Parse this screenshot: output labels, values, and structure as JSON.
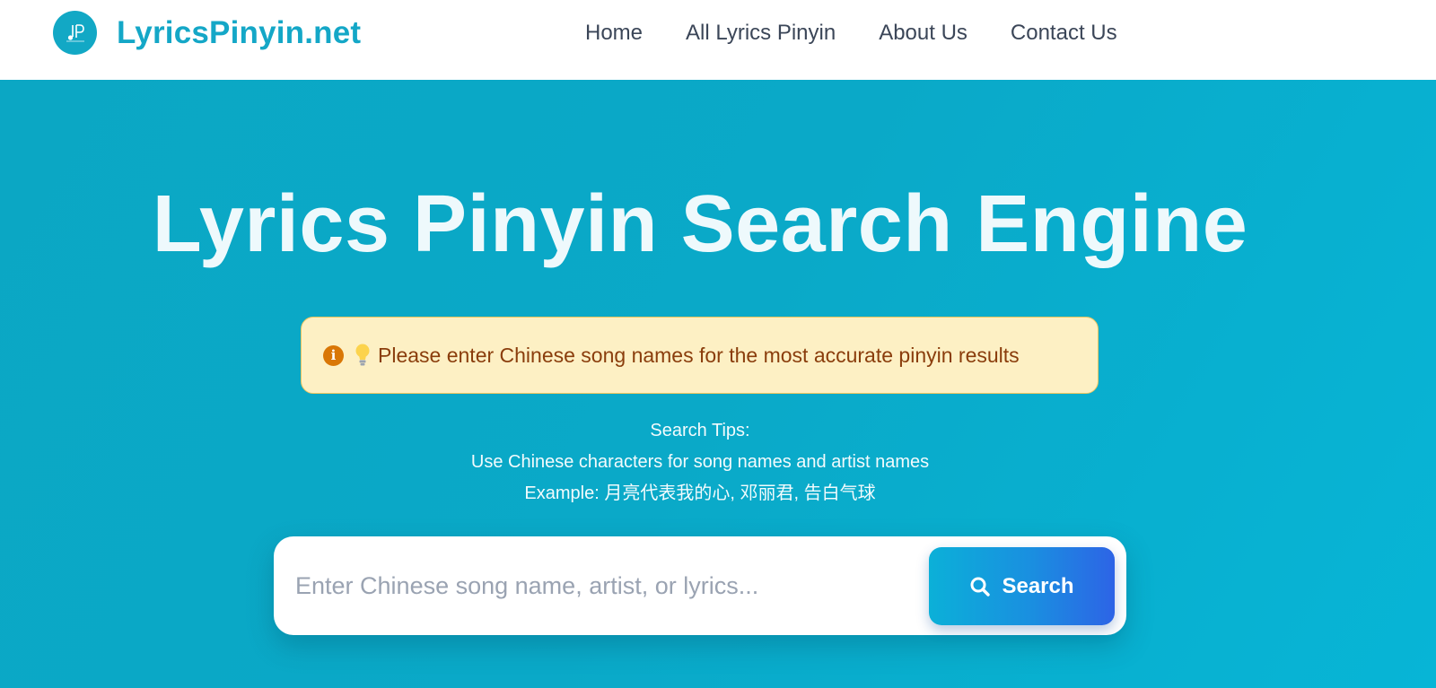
{
  "brand": {
    "name": "LyricsPinyin.net",
    "color": "#14a7c7"
  },
  "nav": {
    "items": [
      {
        "label": "Home"
      },
      {
        "label": "All Lyrics Pinyin"
      },
      {
        "label": "About Us"
      },
      {
        "label": "Contact Us"
      }
    ]
  },
  "hero": {
    "title": "Lyrics Pinyin Search Engine",
    "background": "#0aa8c7"
  },
  "notice": {
    "text": "Please enter Chinese song names for the most accurate pinyin results",
    "info_icon": "info-circle-icon",
    "bulb_icon": "lightbulb-icon"
  },
  "tips": {
    "heading": "Search Tips:",
    "line1": "Use Chinese characters for song names and artist names",
    "line2": "Example: 月亮代表我的心, 邓丽君, 告白气球"
  },
  "search": {
    "placeholder": "Enter Chinese song name, artist, or lyrics...",
    "value": "",
    "button_label": "Search",
    "button_icon": "search-icon"
  }
}
